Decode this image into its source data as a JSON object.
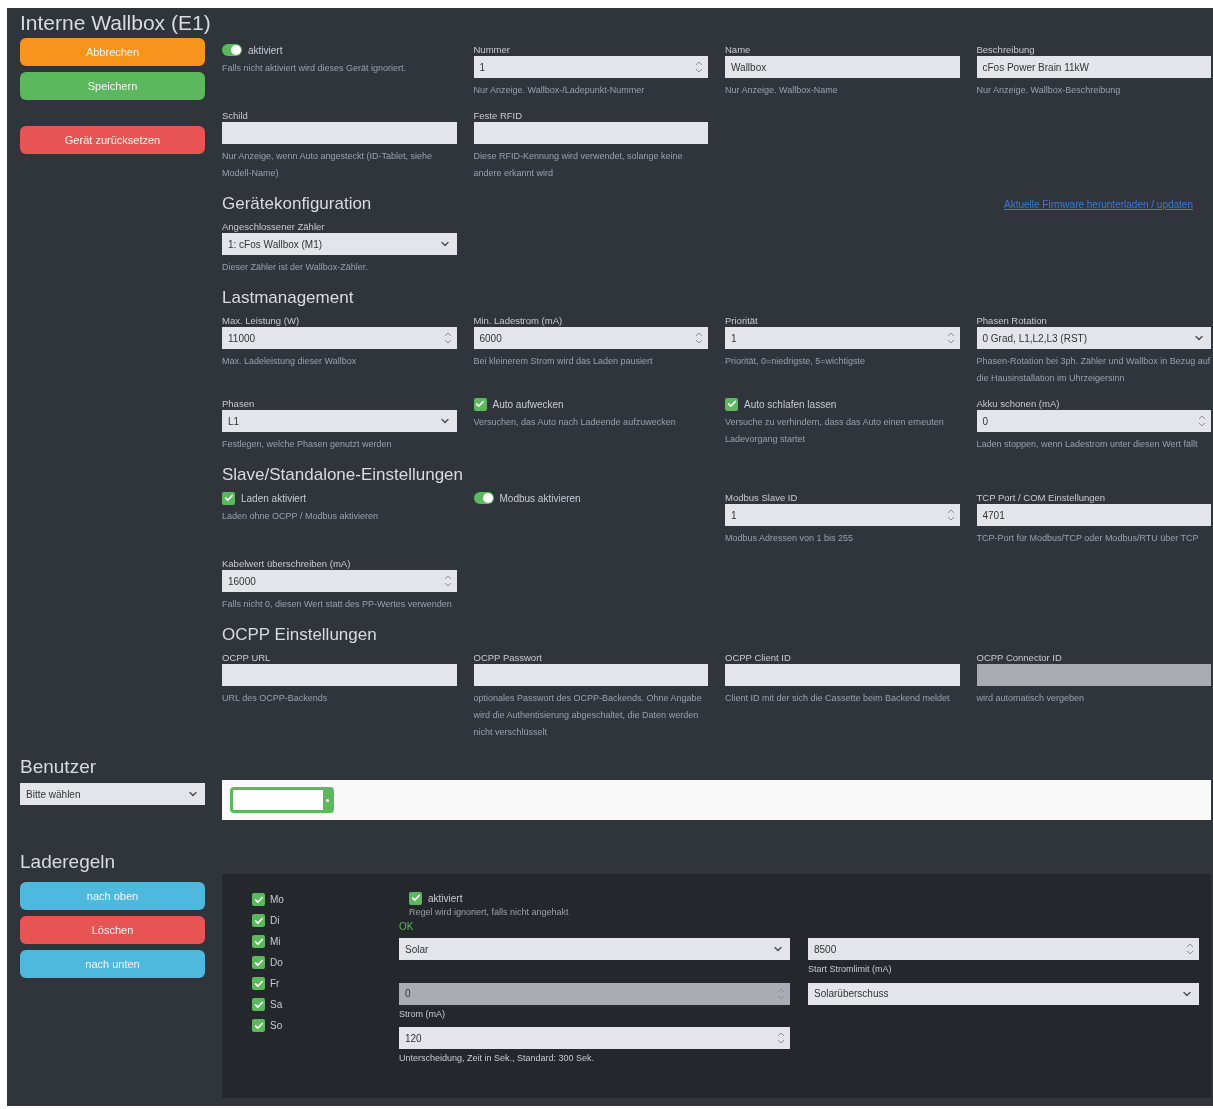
{
  "device": {
    "title": "Interne Wallbox (E1)",
    "buttons": [
      {
        "label": "Abbrechen",
        "kind": "warning"
      },
      {
        "label": "Speichern",
        "kind": "success"
      },
      {
        "label": "Gerät zurücksetzen",
        "kind": "danger"
      }
    ],
    "rows": [
      {
        "kind": "fields",
        "cells": [
          {
            "kind": "toggle",
            "label": "aktiviert",
            "on": true,
            "hint": "Falls nicht aktiviert wird dieses Gerät ignoriert."
          },
          {
            "kind": "number",
            "label": "Nummer",
            "value": "1",
            "hint": "Nur Anzeige. Wallbox-/Ladepunkt-Nummer"
          },
          {
            "kind": "text",
            "label": "Name",
            "value": "Wallbox",
            "hint": "Nur Anzeige. Wallbox-Name"
          },
          {
            "kind": "text",
            "label": "Beschreibung",
            "value": "cFos Power Brain 11kW",
            "hint": "Nur Anzeige. Wallbox-Beschreibung"
          }
        ]
      },
      {
        "kind": "fields",
        "cells": [
          {
            "kind": "text",
            "label": "Schild",
            "hint": "Nur Anzeige, wenn Auto angesteckt (ID-Tablet, siehe Modell-Name)"
          },
          {
            "kind": "text",
            "label": "Feste RFID",
            "hint": "Diese RFID-Kennung wird verwendet, solange keine andere erkannt wird"
          },
          null,
          null
        ]
      },
      {
        "kind": "heading",
        "text": "Gerätekonfiguration",
        "link": "Aktuelle Firmware herunterladen / updaten"
      },
      {
        "kind": "fields",
        "cells": [
          {
            "kind": "select",
            "label": "Angeschlossener Zähler",
            "value": "1: cFos Wallbox (M1)",
            "hint": "Dieser Zähler ist der Wallbox-Zähler."
          },
          null,
          null,
          null
        ]
      },
      {
        "kind": "heading",
        "text": "Lastmanagement"
      },
      {
        "kind": "fields",
        "cells": [
          {
            "kind": "number",
            "label": "Max. Leistung (W)",
            "value": "11000",
            "hint": "Max. Ladeleistung dieser Wallbox"
          },
          {
            "kind": "number",
            "label": "Min. Ladestrom (mA)",
            "value": "6000",
            "hint": "Bei kleinerem Strom wird das Laden pausiert"
          },
          {
            "kind": "number",
            "label": "Priorität",
            "value": "1",
            "hint": "Priorität, 0=niedrigste, 5=wichtigste"
          },
          {
            "kind": "select",
            "label": "Phasen Rotation",
            "value": "0 Grad, L1,L2,L3 (RST)",
            "hint": "Phasen-Rotation bei 3ph. Zähler und Wallbox in Bezug auf die Hausinstallation im Uhrzeigersinn"
          }
        ]
      },
      {
        "kind": "fields",
        "cells": [
          {
            "kind": "select",
            "label": "Phasen",
            "value": "L1",
            "hint": "Festlegen, welche Phasen genutzt werden"
          },
          {
            "kind": "checkbox",
            "label": "Auto aufwecken",
            "checked": true,
            "hint": "Versuchen, das Auto nach Ladeende aufzuwecken"
          },
          {
            "kind": "checkbox",
            "label": "Auto schlafen lassen",
            "checked": true,
            "hint": "Versuche zu verhindern, dass das Auto einen erneuten Ladevorgang startet"
          },
          {
            "kind": "number",
            "label": "Akku schonen (mA)",
            "value": "0",
            "hint": "Laden stoppen, wenn Ladestrom unter diesen Wert fällt"
          }
        ]
      },
      {
        "kind": "heading",
        "text": "Slave/Standalone-Einstellungen"
      },
      {
        "kind": "fields",
        "cells": [
          {
            "kind": "checkbox",
            "label": "Laden aktiviert",
            "checked": true,
            "hint": "Laden ohne OCPP / Modbus aktivieren"
          },
          {
            "kind": "toggle",
            "label": "Modbus aktivieren",
            "on": true
          },
          {
            "kind": "number",
            "label": "Modbus Slave ID",
            "value": "1",
            "hint": "Modbus Adressen von 1 bis 255"
          },
          {
            "kind": "text",
            "label": "TCP Port / COM Einstellungen",
            "value": "4701",
            "hint": "TCP-Port für Modbus/TCP oder Modbus/RTU über TCP"
          }
        ]
      },
      {
        "kind": "fields",
        "cells": [
          {
            "kind": "number",
            "label": "Kabelwert überschreiben (mA)",
            "value": "16000",
            "hint": "Falls nicht 0, diesen Wert statt des PP-Wertes verwenden"
          },
          null,
          null,
          null
        ]
      },
      {
        "kind": "heading",
        "text": "OCPP Einstellungen"
      },
      {
        "kind": "fields",
        "cells": [
          {
            "kind": "text",
            "label": "OCPP URL",
            "hint": "URL des OCPP-Backends"
          },
          {
            "kind": "text",
            "label": "OCPP Passwort",
            "hint": "optionales Passwort des OCPP-Backends. Ohne Angabe wird die Authentisierung abgeschaltet, die Daten werden nicht verschlüsselt"
          },
          {
            "kind": "text",
            "label": "OCPP Client ID",
            "hint": "Client ID mit der sich die Cassette beim Backend meldet"
          },
          {
            "kind": "text",
            "label": "OCPP Connector ID",
            "disabled": true,
            "hint": "wird automatisch vergeben"
          }
        ]
      }
    ]
  },
  "users": {
    "title": "Benutzer",
    "select": "Bitte wählen"
  },
  "rules": {
    "title": "Laderegeln",
    "buttons": [
      {
        "label": "nach oben",
        "kind": "info"
      },
      {
        "label": "Löschen",
        "kind": "danger"
      },
      {
        "label": "nach unten",
        "kind": "info"
      }
    ],
    "days": [
      {
        "label": "Mo",
        "checked": true
      },
      {
        "label": "Di",
        "checked": true
      },
      {
        "label": "Mi",
        "checked": true
      },
      {
        "label": "Do",
        "checked": true
      },
      {
        "label": "Fr",
        "checked": true
      },
      {
        "label": "Sa",
        "checked": true
      },
      {
        "label": "So",
        "checked": true
      }
    ],
    "active": {
      "label": "aktiviert",
      "checked": true,
      "hint": "Regel wird ignoriert, falls nicht angehakt"
    },
    "status": "OK",
    "mode": "Solar",
    "start_current": {
      "value": "8500",
      "label": "Start Stromlimit (mA)"
    },
    "current": {
      "value": "0",
      "label": "Strom (mA)",
      "disabled": true
    },
    "source": "Solarüberschuss",
    "delay": {
      "value": "120",
      "hint": "Unterscheidung, Zeit in Sek., Standard: 300 Sek."
    }
  }
}
